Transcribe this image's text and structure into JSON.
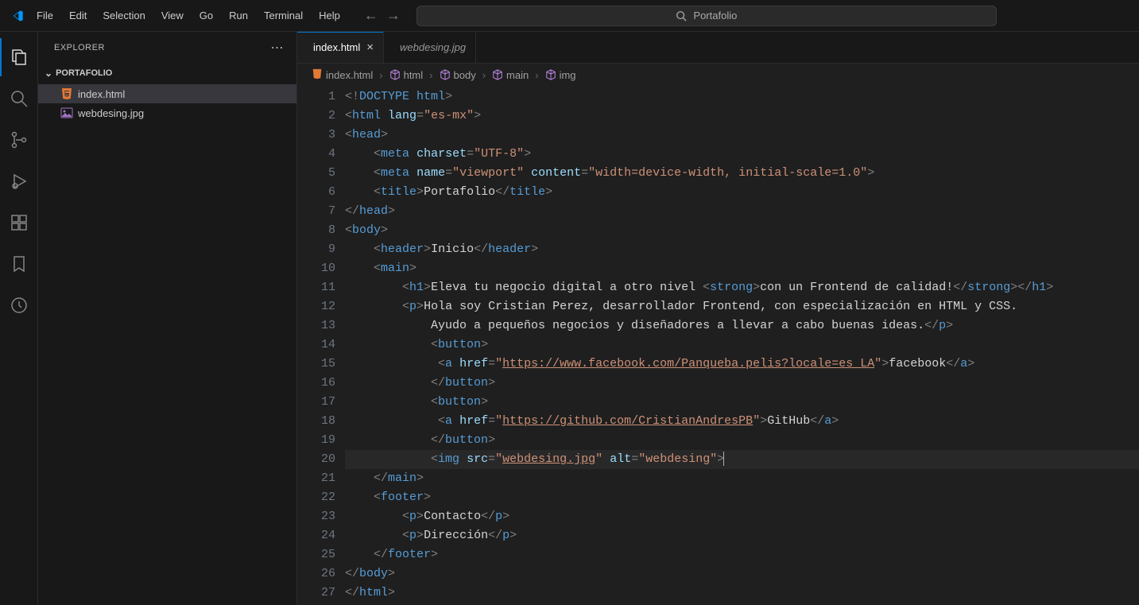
{
  "titlebar": {
    "menu": [
      "File",
      "Edit",
      "Selection",
      "View",
      "Go",
      "Run",
      "Terminal",
      "Help"
    ],
    "search_label": "Portafolio"
  },
  "sidebar": {
    "title": "EXPLORER",
    "folder": "PORTAFOLIO",
    "files": [
      {
        "name": "index.html",
        "type": "html",
        "active": true
      },
      {
        "name": "webdesing.jpg",
        "type": "image",
        "active": false
      }
    ]
  },
  "tabs": [
    {
      "name": "index.html",
      "active": true,
      "icon": "html"
    },
    {
      "name": "webdesing.jpg",
      "active": false,
      "icon": "image",
      "italic": true
    }
  ],
  "breadcrumbs": [
    "index.html",
    "html",
    "body",
    "main",
    "img"
  ],
  "code": {
    "lines": [
      [
        {
          "c": "t-pun",
          "t": "<!"
        },
        {
          "c": "t-doctype",
          "t": "DOCTYPE"
        },
        {
          "c": "t-txt",
          "t": " "
        },
        {
          "c": "t-doctype",
          "t": "html"
        },
        {
          "c": "t-pun",
          "t": ">"
        }
      ],
      [
        {
          "c": "t-pun",
          "t": "<"
        },
        {
          "c": "t-tag",
          "t": "html"
        },
        {
          "c": "t-txt",
          "t": " "
        },
        {
          "c": "t-attr",
          "t": "lang"
        },
        {
          "c": "t-pun",
          "t": "="
        },
        {
          "c": "t-str",
          "t": "\"es-mx\""
        },
        {
          "c": "t-pun",
          "t": ">"
        }
      ],
      [
        {
          "c": "t-pun",
          "t": "<"
        },
        {
          "c": "t-tag",
          "t": "head"
        },
        {
          "c": "t-pun",
          "t": ">"
        }
      ],
      [
        {
          "c": "t-txt",
          "t": "    "
        },
        {
          "c": "t-pun",
          "t": "<"
        },
        {
          "c": "t-tag",
          "t": "meta"
        },
        {
          "c": "t-txt",
          "t": " "
        },
        {
          "c": "t-attr",
          "t": "charset"
        },
        {
          "c": "t-pun",
          "t": "="
        },
        {
          "c": "t-str",
          "t": "\"UTF-8\""
        },
        {
          "c": "t-pun",
          "t": ">"
        }
      ],
      [
        {
          "c": "t-txt",
          "t": "    "
        },
        {
          "c": "t-pun",
          "t": "<"
        },
        {
          "c": "t-tag",
          "t": "meta"
        },
        {
          "c": "t-txt",
          "t": " "
        },
        {
          "c": "t-attr",
          "t": "name"
        },
        {
          "c": "t-pun",
          "t": "="
        },
        {
          "c": "t-str",
          "t": "\"viewport\""
        },
        {
          "c": "t-txt",
          "t": " "
        },
        {
          "c": "t-attr",
          "t": "content"
        },
        {
          "c": "t-pun",
          "t": "="
        },
        {
          "c": "t-str",
          "t": "\"width=device-width, initial-scale=1.0\""
        },
        {
          "c": "t-pun",
          "t": ">"
        }
      ],
      [
        {
          "c": "t-txt",
          "t": "    "
        },
        {
          "c": "t-pun",
          "t": "<"
        },
        {
          "c": "t-tag",
          "t": "title"
        },
        {
          "c": "t-pun",
          "t": ">"
        },
        {
          "c": "t-txt",
          "t": "Portafolio"
        },
        {
          "c": "t-pun",
          "t": "</"
        },
        {
          "c": "t-tag",
          "t": "title"
        },
        {
          "c": "t-pun",
          "t": ">"
        }
      ],
      [
        {
          "c": "t-pun",
          "t": "</"
        },
        {
          "c": "t-tag",
          "t": "head"
        },
        {
          "c": "t-pun",
          "t": ">"
        }
      ],
      [
        {
          "c": "t-pun",
          "t": "<"
        },
        {
          "c": "t-tag",
          "t": "body"
        },
        {
          "c": "t-pun",
          "t": ">"
        }
      ],
      [
        {
          "c": "t-txt",
          "t": "    "
        },
        {
          "c": "t-pun",
          "t": "<"
        },
        {
          "c": "t-tag",
          "t": "header"
        },
        {
          "c": "t-pun",
          "t": ">"
        },
        {
          "c": "t-txt",
          "t": "Inicio"
        },
        {
          "c": "t-pun",
          "t": "</"
        },
        {
          "c": "t-tag",
          "t": "header"
        },
        {
          "c": "t-pun",
          "t": ">"
        }
      ],
      [
        {
          "c": "t-txt",
          "t": "    "
        },
        {
          "c": "t-pun",
          "t": "<"
        },
        {
          "c": "t-tag",
          "t": "main"
        },
        {
          "c": "t-pun",
          "t": ">"
        }
      ],
      [
        {
          "c": "t-txt",
          "t": "        "
        },
        {
          "c": "t-pun",
          "t": "<"
        },
        {
          "c": "t-tag",
          "t": "h1"
        },
        {
          "c": "t-pun",
          "t": ">"
        },
        {
          "c": "t-txt",
          "t": "Eleva tu negocio digital a otro nivel "
        },
        {
          "c": "t-pun",
          "t": "<"
        },
        {
          "c": "t-tag",
          "t": "strong"
        },
        {
          "c": "t-pun",
          "t": ">"
        },
        {
          "c": "t-txt",
          "t": "con un Frontend de calidad!"
        },
        {
          "c": "t-pun",
          "t": "</"
        },
        {
          "c": "t-tag",
          "t": "strong"
        },
        {
          "c": "t-pun",
          "t": ">"
        },
        {
          "c": "t-pun",
          "t": "</"
        },
        {
          "c": "t-tag",
          "t": "h1"
        },
        {
          "c": "t-pun",
          "t": ">"
        }
      ],
      [
        {
          "c": "t-txt",
          "t": "        "
        },
        {
          "c": "t-pun",
          "t": "<"
        },
        {
          "c": "t-tag",
          "t": "p"
        },
        {
          "c": "t-pun",
          "t": ">"
        },
        {
          "c": "t-txt",
          "t": "Hola soy Cristian Perez, desarrollador Frontend, con especialización en HTML y CSS."
        }
      ],
      [
        {
          "c": "t-txt",
          "t": "            Ayudo a pequeños negocios y diseñadores a llevar a cabo buenas ideas."
        },
        {
          "c": "t-pun",
          "t": "</"
        },
        {
          "c": "t-tag",
          "t": "p"
        },
        {
          "c": "t-pun",
          "t": ">"
        }
      ],
      [
        {
          "c": "t-txt",
          "t": "            "
        },
        {
          "c": "t-pun",
          "t": "<"
        },
        {
          "c": "t-tag",
          "t": "button"
        },
        {
          "c": "t-pun",
          "t": ">"
        }
      ],
      [
        {
          "c": "t-txt",
          "t": "             "
        },
        {
          "c": "t-pun",
          "t": "<"
        },
        {
          "c": "t-tag",
          "t": "a"
        },
        {
          "c": "t-txt",
          "t": " "
        },
        {
          "c": "t-attr",
          "t": "href"
        },
        {
          "c": "t-pun",
          "t": "="
        },
        {
          "c": "t-str",
          "t": "\""
        },
        {
          "c": "t-url",
          "t": "https://www.facebook.com/Panqueba.pelis?locale=es_LA"
        },
        {
          "c": "t-str",
          "t": "\""
        },
        {
          "c": "t-pun",
          "t": ">"
        },
        {
          "c": "t-txt",
          "t": "facebook"
        },
        {
          "c": "t-pun",
          "t": "</"
        },
        {
          "c": "t-tag",
          "t": "a"
        },
        {
          "c": "t-pun",
          "t": ">"
        }
      ],
      [
        {
          "c": "t-txt",
          "t": "            "
        },
        {
          "c": "t-pun",
          "t": "</"
        },
        {
          "c": "t-tag",
          "t": "button"
        },
        {
          "c": "t-pun",
          "t": ">"
        }
      ],
      [
        {
          "c": "t-txt",
          "t": "            "
        },
        {
          "c": "t-pun",
          "t": "<"
        },
        {
          "c": "t-tag",
          "t": "button"
        },
        {
          "c": "t-pun",
          "t": ">"
        }
      ],
      [
        {
          "c": "t-txt",
          "t": "             "
        },
        {
          "c": "t-pun",
          "t": "<"
        },
        {
          "c": "t-tag",
          "t": "a"
        },
        {
          "c": "t-txt",
          "t": " "
        },
        {
          "c": "t-attr",
          "t": "href"
        },
        {
          "c": "t-pun",
          "t": "="
        },
        {
          "c": "t-str",
          "t": "\""
        },
        {
          "c": "t-url",
          "t": "https://github.com/CristianAndresPB"
        },
        {
          "c": "t-str",
          "t": "\""
        },
        {
          "c": "t-pun",
          "t": ">"
        },
        {
          "c": "t-txt",
          "t": "GitHub"
        },
        {
          "c": "t-pun",
          "t": "</"
        },
        {
          "c": "t-tag",
          "t": "a"
        },
        {
          "c": "t-pun",
          "t": ">"
        }
      ],
      [
        {
          "c": "t-txt",
          "t": "            "
        },
        {
          "c": "t-pun",
          "t": "</"
        },
        {
          "c": "t-tag",
          "t": "button"
        },
        {
          "c": "t-pun",
          "t": ">"
        }
      ],
      [
        {
          "c": "t-txt",
          "t": "            "
        },
        {
          "c": "t-pun",
          "t": "<"
        },
        {
          "c": "t-tag",
          "t": "img"
        },
        {
          "c": "t-txt",
          "t": " "
        },
        {
          "c": "t-attr",
          "t": "src"
        },
        {
          "c": "t-pun",
          "t": "="
        },
        {
          "c": "t-str",
          "t": "\""
        },
        {
          "c": "t-url",
          "t": "webdesing.jpg"
        },
        {
          "c": "t-str",
          "t": "\""
        },
        {
          "c": "t-txt",
          "t": " "
        },
        {
          "c": "t-attr",
          "t": "alt"
        },
        {
          "c": "t-pun",
          "t": "="
        },
        {
          "c": "t-str",
          "t": "\"webdesing\""
        },
        {
          "c": "t-pun",
          "t": ">"
        }
      ],
      [
        {
          "c": "t-txt",
          "t": "    "
        },
        {
          "c": "t-pun",
          "t": "</"
        },
        {
          "c": "t-tag",
          "t": "main"
        },
        {
          "c": "t-pun",
          "t": ">"
        }
      ],
      [
        {
          "c": "t-txt",
          "t": "    "
        },
        {
          "c": "t-pun",
          "t": "<"
        },
        {
          "c": "t-tag",
          "t": "footer"
        },
        {
          "c": "t-pun",
          "t": ">"
        }
      ],
      [
        {
          "c": "t-txt",
          "t": "        "
        },
        {
          "c": "t-pun",
          "t": "<"
        },
        {
          "c": "t-tag",
          "t": "p"
        },
        {
          "c": "t-pun",
          "t": ">"
        },
        {
          "c": "t-txt",
          "t": "Contacto"
        },
        {
          "c": "t-pun",
          "t": "</"
        },
        {
          "c": "t-tag",
          "t": "p"
        },
        {
          "c": "t-pun",
          "t": ">"
        }
      ],
      [
        {
          "c": "t-txt",
          "t": "        "
        },
        {
          "c": "t-pun",
          "t": "<"
        },
        {
          "c": "t-tag",
          "t": "p"
        },
        {
          "c": "t-pun",
          "t": ">"
        },
        {
          "c": "t-txt",
          "t": "Dirección"
        },
        {
          "c": "t-pun",
          "t": "</"
        },
        {
          "c": "t-tag",
          "t": "p"
        },
        {
          "c": "t-pun",
          "t": ">"
        }
      ],
      [
        {
          "c": "t-txt",
          "t": "    "
        },
        {
          "c": "t-pun",
          "t": "</"
        },
        {
          "c": "t-tag",
          "t": "footer"
        },
        {
          "c": "t-pun",
          "t": ">"
        }
      ],
      [
        {
          "c": "t-pun",
          "t": "</"
        },
        {
          "c": "t-tag",
          "t": "body"
        },
        {
          "c": "t-pun",
          "t": ">"
        }
      ],
      [
        {
          "c": "t-pun",
          "t": "</"
        },
        {
          "c": "t-tag",
          "t": "html"
        },
        {
          "c": "t-pun",
          "t": ">"
        }
      ]
    ],
    "highlight_line": 20
  }
}
